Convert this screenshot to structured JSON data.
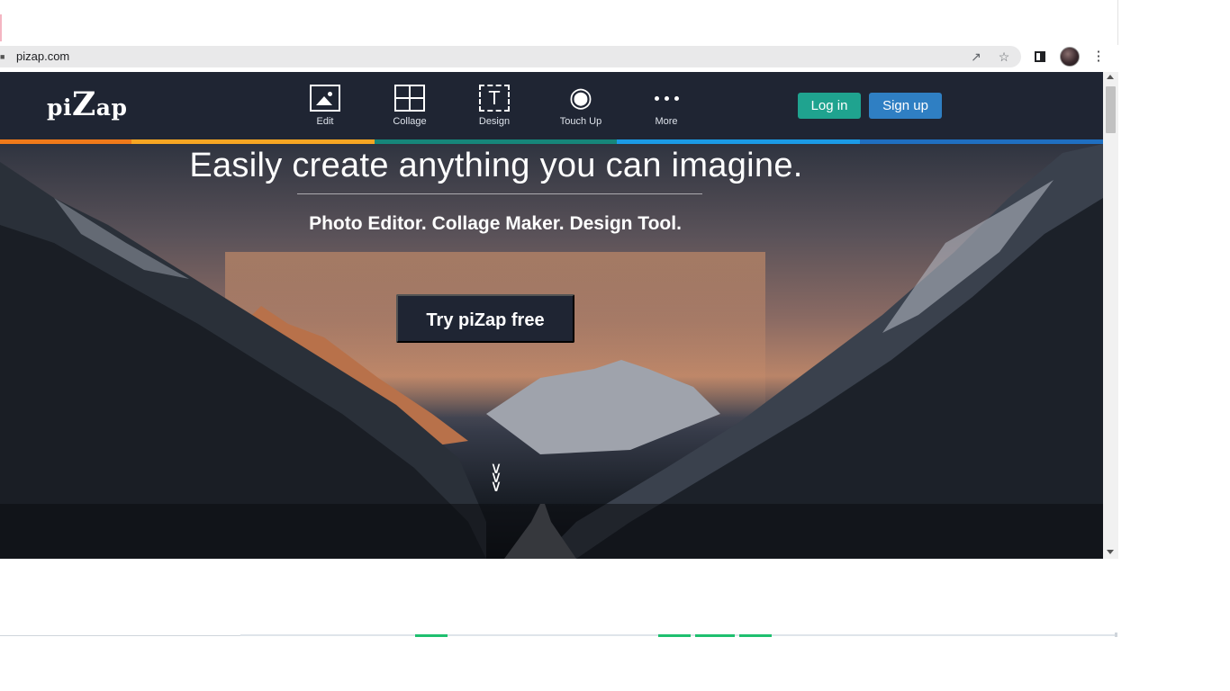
{
  "browser": {
    "url": "pizap.com",
    "icons": {
      "lock": "lock-icon",
      "share": "share-icon",
      "bookmark": "star-icon",
      "side_panel": "side-panel-icon",
      "profile": "avatar",
      "menu": "kebab-menu-icon"
    }
  },
  "site": {
    "logo": {
      "part1": "pi",
      "part2": "Z",
      "part3": "ap"
    },
    "nav": [
      {
        "label": "Edit",
        "icon": "image-icon"
      },
      {
        "label": "Collage",
        "icon": "collage-grid-icon"
      },
      {
        "label": "Design",
        "icon": "text-box-icon"
      },
      {
        "label": "Touch Up",
        "icon": "eye-icon"
      },
      {
        "label": "More",
        "icon": "more-dots-icon"
      }
    ],
    "login_label": "Log in",
    "signup_label": "Sign up",
    "design_glyph": "T",
    "colors": {
      "header": "#1f2533",
      "login": "#1fa38f",
      "signup": "#2f7fc3",
      "bar_orange": "#f07a1a",
      "bar_yellow": "#f6a623",
      "bar_teal": "#16867a",
      "bar_blue": "#1b9be6",
      "bar_blue2": "#1f6fc1"
    }
  },
  "hero": {
    "title": "Easily create anything you can imagine.",
    "subtitle": "Photo Editor. Collage Maker. Design Tool.",
    "cta_label": "Try piZap free",
    "scroll_icon": "double-chevron-down-icon"
  }
}
